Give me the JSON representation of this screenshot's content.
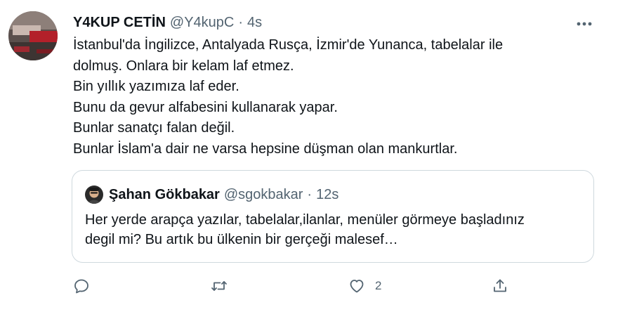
{
  "tweet": {
    "author_name": "Y4KUP CETİN",
    "author_handle": "@Y4kupC",
    "separator": "·",
    "time": "4s",
    "lines": [
      "İstanbul'da İngilizce, Antalyada Rusça, İzmir'de Yunanca, tabelalar ile",
      "dolmuş. Onlara bir kelam laf etmez.",
      "Bin yıllık yazımıza laf eder.",
      "Bunu da gevur alfabesini kullanarak yapar.",
      "Bunlar sanatçı falan değil.",
      "Bunlar İslam'a dair ne varsa hepsine düşman olan mankurtlar."
    ]
  },
  "quote": {
    "author_name": "Şahan Gökbakar",
    "author_handle": "@sgokbakar",
    "separator": "·",
    "time": "12s",
    "lines": [
      "Her yerde arapça yazılar, tabelalar,ilanlar, menüler görmeye başladınız",
      "degil mi? Bu artık bu ülkenin bir gerçeği malesef…"
    ]
  },
  "actions": {
    "like_count": "2"
  },
  "icons": {
    "more": "more-horizontal-icon",
    "reply": "reply-icon",
    "retweet": "retweet-icon",
    "like": "heart-icon",
    "share": "share-icon"
  },
  "colors": {
    "text": "#0f1419",
    "secondary": "#536471",
    "border": "#cfd9de"
  }
}
